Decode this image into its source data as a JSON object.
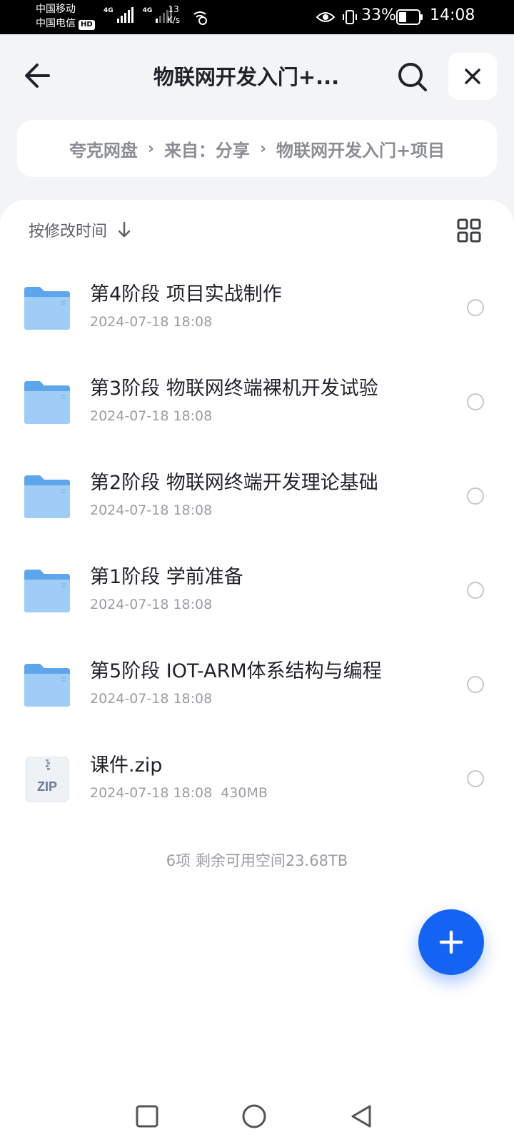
{
  "status_bar": {
    "carrier_1": "中国移动",
    "carrier_2": "中国电信",
    "hd_badge": "HD",
    "network_1": "4G",
    "network_2": "4G",
    "speed_value": "13",
    "speed_unit": "K/s",
    "battery": "33%",
    "time": "14:08"
  },
  "header": {
    "title": "物联网开发入门+..."
  },
  "breadcrumb": {
    "items": [
      "夸克网盘",
      "来自：分享",
      "物联网开发入门+项目"
    ],
    "separator": "›"
  },
  "sort": {
    "label": "按修改时间"
  },
  "files": [
    {
      "name": "第4阶段 项目实战制作",
      "date": "2024-07-18 18:08",
      "size": "",
      "type": "folder"
    },
    {
      "name": "第3阶段 物联网终端裸机开发试验",
      "date": "2024-07-18 18:08",
      "size": "",
      "type": "folder"
    },
    {
      "name": "第2阶段 物联网终端开发理论基础",
      "date": "2024-07-18 18:08",
      "size": "",
      "type": "folder"
    },
    {
      "name": "第1阶段 学前准备",
      "date": "2024-07-18 18:08",
      "size": "",
      "type": "folder"
    },
    {
      "name": "第5阶段 IOT-ARM体系结构与编程",
      "date": "2024-07-18 18:08",
      "size": "",
      "type": "folder"
    },
    {
      "name": "课件.zip",
      "date": "2024-07-18 18:08",
      "size": "430MB",
      "type": "zip"
    }
  ],
  "zip_icon_label": "ZIP",
  "summary": "6项 剩余可用空间23.68TB",
  "colors": {
    "accent": "#1463f3",
    "folder": "#79b8f2",
    "background": "#f3f4f6"
  }
}
